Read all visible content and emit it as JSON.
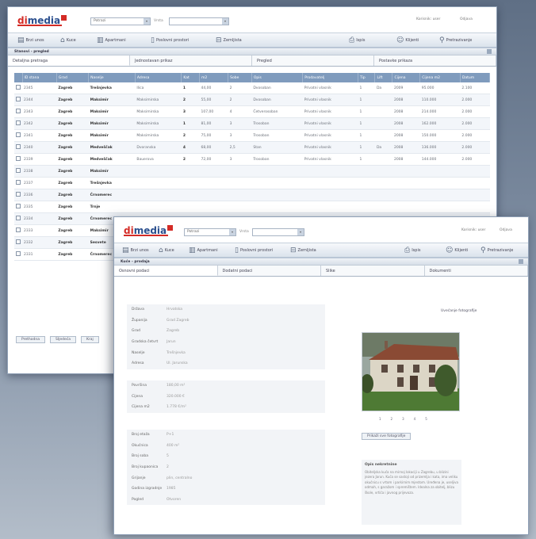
{
  "app": {
    "logo_text": "dimedia",
    "top_links": [
      "Korisnik: user",
      "Odjava"
    ],
    "select_value": "Potrazi",
    "select_mid_label": "Vrsta"
  },
  "toolbar": [
    {
      "label": "Brzi unos",
      "icon": "form-icon"
    },
    {
      "label": "Kuce",
      "icon": "house-icon"
    },
    {
      "label": "Apartmani",
      "icon": "apartment-icon"
    },
    {
      "label": "Poslovni prostori",
      "icon": "building-icon"
    },
    {
      "label": "Zemljista",
      "icon": "land-icon"
    }
  ],
  "toolbar_right": [
    {
      "label": "Ispis",
      "icon": "print-icon"
    },
    {
      "label": "Klijenti",
      "icon": "users-icon"
    },
    {
      "label": "Pretrazivanje",
      "icon": "search-icon"
    }
  ],
  "list_window": {
    "crumb": "Stanovi - pregled",
    "tabs": [
      "Detaljna pretraga",
      "Jednostavan prikaz",
      "Pregled",
      "Postavke prikaza"
    ],
    "columns": [
      "ID stana",
      "Grad",
      "Naselje",
      "Adresa",
      "Kat",
      "m2",
      "Sobe",
      "Opis",
      "Prodavatelj",
      "Tip",
      "Lift",
      "Cijena",
      "Cijena m2",
      "Datum"
    ],
    "rows": [
      [
        "2345",
        "Zagreb",
        "Trešnjevka",
        "Ilica",
        "1",
        "44,00",
        "2",
        "Dvosoban",
        "Privatni vlasnik",
        "1",
        "Da",
        "2009",
        "95.000",
        "2.100",
        "15.03.2009"
      ],
      [
        "2344",
        "Zagreb",
        "Maksimir",
        "Maksimirska",
        "2",
        "55,00",
        "2",
        "Dvosoban",
        "Privatni vlasnik",
        "1",
        "",
        "2008",
        "110.000",
        "2.000",
        "14.03.2009"
      ],
      [
        "2343",
        "Zagreb",
        "Maksimir",
        "Maksimirska",
        "3",
        "107,00",
        "4",
        "Četverosoban",
        "Privatni vlasnik",
        "1",
        "",
        "2008",
        "214.000",
        "2.000",
        "14.03.2009"
      ],
      [
        "2342",
        "Zagreb",
        "Maksimir",
        "Maksimirska",
        "1",
        "81,00",
        "3",
        "Trosoban",
        "Privatni vlasnik",
        "1",
        "",
        "2008",
        "162.000",
        "2.000",
        "13.03.2009"
      ],
      [
        "2341",
        "Zagreb",
        "Maksimir",
        "Maksimirska",
        "2",
        "75,00",
        "3",
        "Trosoban",
        "Privatni vlasnik",
        "1",
        "",
        "2008",
        "150.000",
        "2.000",
        "13.03.2009"
      ],
      [
        "2340",
        "Zagreb",
        "Medveščak",
        "Dvoranska",
        "4",
        "68,00",
        "2,5",
        "Stan",
        "Privatni vlasnik",
        "1",
        "Da",
        "2008",
        "136.000",
        "2.000",
        "12.03.2009"
      ],
      [
        "2339",
        "Zagreb",
        "Medveščak",
        "Bauerova",
        "2",
        "72,00",
        "3",
        "Trosoban",
        "Privatni vlasnik",
        "1",
        "",
        "2008",
        "144.000",
        "2.000",
        "12.03.2009"
      ],
      [
        "2338",
        "Zagreb",
        "Maksimir",
        "",
        "",
        "",
        "",
        "",
        "",
        "",
        "",
        "",
        "",
        "",
        ""
      ],
      [
        "2337",
        "Zagreb",
        "Trešnjevka",
        "",
        "",
        "",
        "",
        "",
        "",
        "",
        "",
        "",
        "",
        "",
        ""
      ],
      [
        "2336",
        "Zagreb",
        "Črnomerec",
        "",
        "",
        "",
        "",
        "",
        "",
        "",
        "",
        "",
        "",
        "",
        ""
      ],
      [
        "2335",
        "Zagreb",
        "Trnje",
        "",
        "",
        "",
        "",
        "",
        "",
        "",
        "",
        "",
        "",
        "",
        ""
      ],
      [
        "2334",
        "Zagreb",
        "Črnomerec",
        "",
        "",
        "",
        "",
        "",
        "",
        "",
        "",
        "",
        "",
        "",
        ""
      ],
      [
        "2333",
        "Zagreb",
        "Maksimir",
        "",
        "",
        "",
        "",
        "",
        "",
        "",
        "",
        "",
        "",
        "",
        ""
      ],
      [
        "2332",
        "Zagreb",
        "Sesvete",
        "",
        "",
        "",
        "",
        "",
        "",
        "",
        "",
        "",
        "",
        "",
        ""
      ],
      [
        "2331",
        "Zagreb",
        "Črnomerec",
        "",
        "",
        "",
        "",
        "",
        "",
        "",
        "",
        "",
        "",
        "",
        ""
      ]
    ],
    "pager": [
      "Prethodna",
      "Sljedeća",
      "Kraj"
    ]
  },
  "detail_window": {
    "crumb": "Kuće - prodaja",
    "tabs": [
      "Osnovni podaci",
      "Dodatni podaci",
      "Slike",
      "Dokumenti"
    ],
    "groups": [
      [
        {
          "k": "Država",
          "v": "Hrvatska"
        },
        {
          "k": "Županija",
          "v": "Grad Zagreb"
        },
        {
          "k": "Grad",
          "v": "Zagreb"
        },
        {
          "k": "Gradska četvrt",
          "v": "Jarun"
        },
        {
          "k": "Naselje",
          "v": "Trešnjevka"
        },
        {
          "k": "Adresa",
          "v": "Ul. Jarunska"
        }
      ],
      [
        {
          "k": "Površina",
          "v": "180,00 m²"
        },
        {
          "k": "Cijena",
          "v": "320.000 €"
        },
        {
          "k": "Cijena m2",
          "v": "1.778 €/m²"
        }
      ],
      [
        {
          "k": "Broj etaža",
          "v": "P+1"
        },
        {
          "k": "Okućnica",
          "v": "400 m²"
        },
        {
          "k": "Broj soba",
          "v": "5"
        },
        {
          "k": "Broj kupaonica",
          "v": "2"
        },
        {
          "k": "Grijanje",
          "v": "plin, centralno"
        },
        {
          "k": "Godina izgradnje",
          "v": "1985"
        },
        {
          "k": "Pogled",
          "v": "Otvoren"
        }
      ]
    ],
    "gallery_label": "Uvećanje fotografije",
    "thumb_numbers": [
      "1",
      "2",
      "3",
      "4",
      "5"
    ],
    "gallery_button": "Prikaži sve fotografije",
    "info_title": "Opis nekretnine",
    "info_text": "Obiteljska kuća na mirnoj lokaciji u Zagrebu, u blizini jezera Jarun. Kuća se sastoji od prizemlja i kata, ima veliku okućnicu s vrtom i parkirnim mjestom. Uređena je, useljiva odmah, s garažom i spremištem. Idealna za obitelj, blizu škole, vrtića i javnog prijevoza."
  },
  "colors": {
    "brand_red": "#d42b26",
    "brand_blue": "#2b4f8e",
    "header_blue": "#7f9bbd"
  }
}
